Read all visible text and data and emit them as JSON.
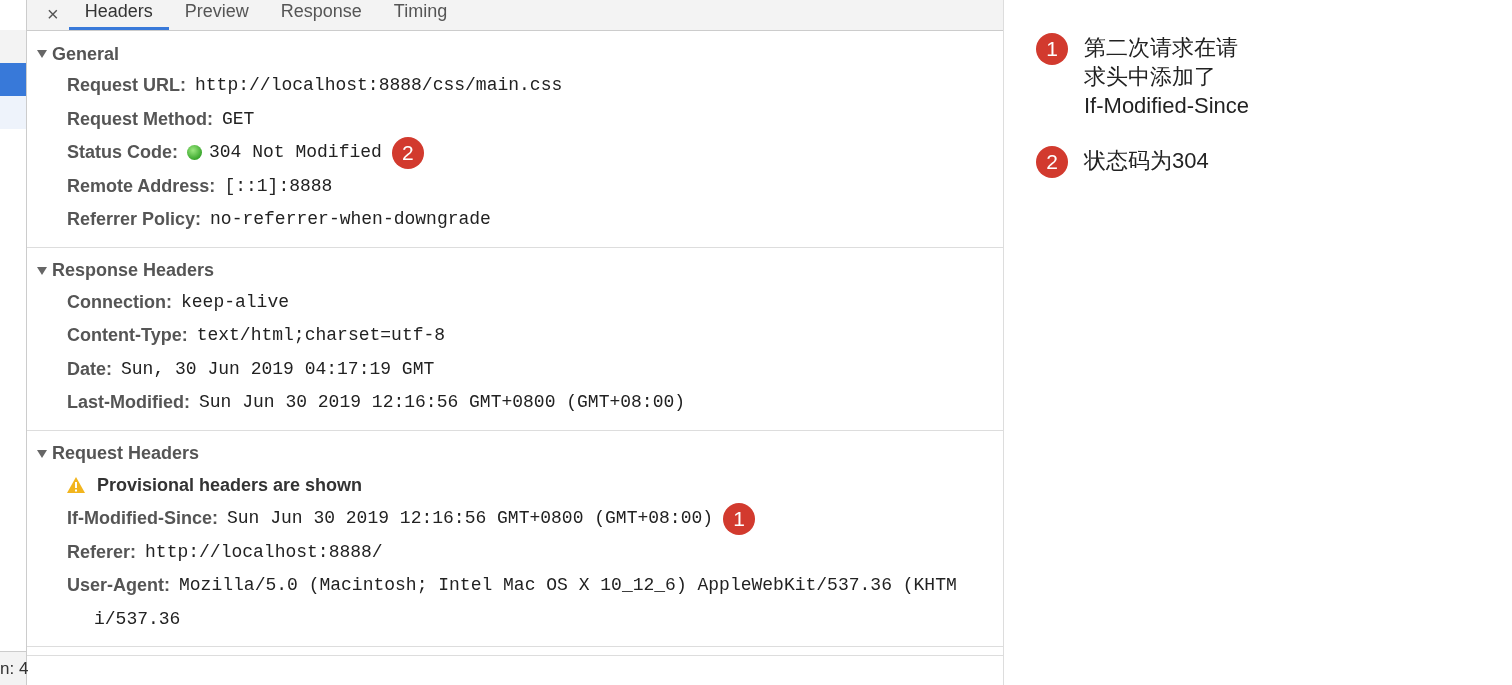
{
  "sidebar": {
    "items": [
      {
        "selected": false
      },
      {
        "selected": true
      },
      {
        "selected": false
      }
    ],
    "status": "n: 4"
  },
  "tabs": {
    "close": "×",
    "items": [
      {
        "label": "Headers",
        "selected": true
      },
      {
        "label": "Preview",
        "selected": false
      },
      {
        "label": "Response",
        "selected": false
      },
      {
        "label": "Timing",
        "selected": false
      }
    ]
  },
  "sections": [
    {
      "title": "General",
      "expanded": true,
      "rows": [
        {
          "kind": "header",
          "name": "Request URL:",
          "value": "http://localhost:8888/css/main.css"
        },
        {
          "kind": "header",
          "name": "Request Method:",
          "value": "GET"
        },
        {
          "kind": "status",
          "name": "Status Code:",
          "value": "304 Not Modified",
          "badge": "2"
        },
        {
          "kind": "header",
          "name": "Remote Address:",
          "value": "[::1]:8888"
        },
        {
          "kind": "header",
          "name": "Referrer Policy:",
          "value": "no-referrer-when-downgrade"
        }
      ]
    },
    {
      "title": "Response Headers",
      "expanded": true,
      "rows": [
        {
          "kind": "header",
          "name": "Connection:",
          "value": "keep-alive"
        },
        {
          "kind": "header",
          "name": "Content-Type:",
          "value": "text/html;charset=utf-8"
        },
        {
          "kind": "header",
          "name": "Date:",
          "value": "Sun, 30 Jun 2019 04:17:19 GMT"
        },
        {
          "kind": "header",
          "name": "Last-Modified:",
          "value": "Sun Jun 30 2019 12:16:56 GMT+0800 (GMT+08:00)"
        }
      ]
    },
    {
      "title": "Request Headers",
      "expanded": true,
      "rows": [
        {
          "kind": "warning",
          "text": "Provisional headers are shown"
        },
        {
          "kind": "header",
          "name": "If-Modified-Since:",
          "value": "Sun Jun 30 2019 12:16:56 GMT+0800 (GMT+08:00)",
          "badge": "1"
        },
        {
          "kind": "header",
          "name": "Referer:",
          "value": "http://localhost:8888/"
        },
        {
          "kind": "header",
          "name": "User-Agent:",
          "value": "Mozilla/5.0 (Macintosh; Intel Mac OS X 10_12_6) AppleWebKit/537.36 (KHTM",
          "continuation": "i/537.36"
        }
      ]
    }
  ],
  "notes": [
    {
      "badge": "1",
      "lines": [
        "第二次请求在请",
        "求头中添加了",
        "If-Modified-Since"
      ]
    },
    {
      "badge": "2",
      "lines": [
        "状态码为304"
      ]
    }
  ]
}
